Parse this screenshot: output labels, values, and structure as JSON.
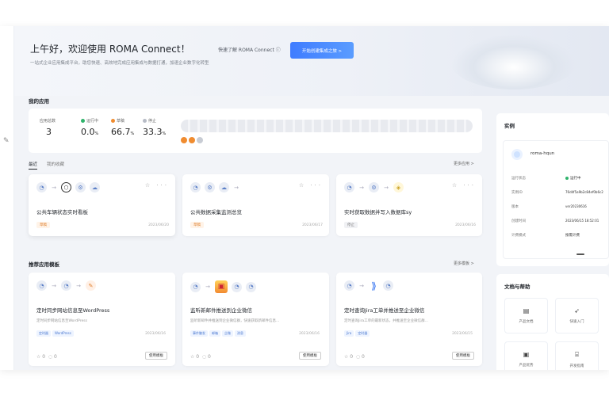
{
  "hero": {
    "greeting": "上午好，欢迎使用 ROMA Connect！",
    "subtitle": "一站式企业应用集成平台，助您快速、高效地完成应用集成与数据打通，加速企业数字化转型",
    "learn_more": "快速了解 ROMA Connect ⓘ",
    "cta": "开始创建集成之旅 >"
  },
  "apps_section": {
    "title": "我的应用",
    "stats": [
      {
        "label": "应用总数",
        "value": "3"
      },
      {
        "label": "运行中",
        "value": "0.0",
        "unit": "%",
        "color": "#2fb36b"
      },
      {
        "label": "草稿",
        "value": "66.7",
        "unit": "%",
        "color": "#f08c30"
      },
      {
        "label": "停止",
        "value": "33.3",
        "unit": "%",
        "color": "#b7bcc6"
      }
    ],
    "tabs": [
      "最近",
      "我的收藏"
    ],
    "more": "更多应用 >"
  },
  "app_cards": [
    {
      "title": "公共车辆状态实时看板",
      "badge": "草稿",
      "date": "2023/06/20"
    },
    {
      "title": "公共数据采集监测总览",
      "badge": "草稿",
      "date": "2023/06/17"
    },
    {
      "title": "实时获取数据并写入数据库sy",
      "badge": "停止",
      "date": "2023/06/16"
    }
  ],
  "templates_section": {
    "title": "推荐应用模板",
    "more": "更多模板 >"
  },
  "template_cards": [
    {
      "title": "定时同步网站信息至WordPress",
      "desc": "定时同步网站信息至WordPress",
      "tags": [
        "定时器",
        "WordPress"
      ],
      "date": "2023/06/16",
      "button": "使用模板"
    },
    {
      "title": "监听新邮件推送到企业微信",
      "desc": "监听新邮件并推送到企业微信群，快速获取新邮件信息...",
      "tags": [
        "事件触发",
        "邮箱",
        "企微",
        "消息"
      ],
      "date": "2023/06/16",
      "button": "使用模板"
    },
    {
      "title": "定时查询Jira工单并推送至企业微信",
      "desc": "定时查询Jira工单的最新状态，并推送至企业微信群...",
      "tags": [
        "Jira",
        "定时器"
      ],
      "date": "2023/06/15",
      "button": "使用模板"
    }
  ],
  "instance": {
    "title": "实例",
    "name": "roma-hqun",
    "fields": [
      {
        "label": "运行状态",
        "value": "运行中"
      },
      {
        "label": "实例ID",
        "value": "76d4f5a9b2c84ef0b6c2"
      },
      {
        "label": "版本",
        "value": "ver20230616"
      },
      {
        "label": "创建时间",
        "value": "2023/06/15 18:52:01"
      },
      {
        "label": "计费模式",
        "value": "按需计费"
      }
    ]
  },
  "docs": {
    "title": "文档与帮助",
    "items": [
      {
        "label": "产品文档",
        "icon": "doc-icon"
      },
      {
        "label": "快速入门",
        "icon": "rocket-icon"
      },
      {
        "label": "产品优势",
        "icon": "star-icon"
      },
      {
        "label": "开发指南",
        "icon": "code-icon"
      }
    ]
  }
}
